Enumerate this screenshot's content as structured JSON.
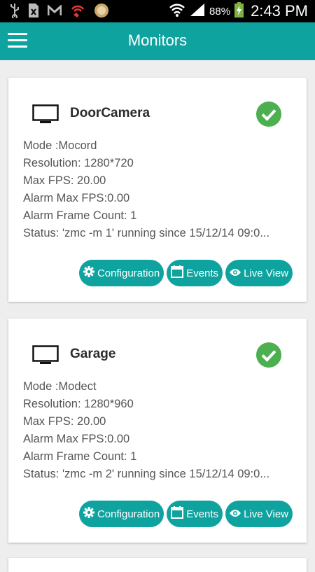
{
  "status_bar": {
    "battery": "88%",
    "time": "2:43 PM",
    "left_icons": [
      "usb-icon",
      "sim-icon",
      "gmail-icon",
      "wifi-calling-icon",
      "app-icon"
    ],
    "right_icons": [
      "wifi-icon",
      "signal-icon",
      "battery-charging-icon"
    ]
  },
  "app_bar": {
    "title": "Monitors",
    "menu_icon": "hamburger-menu-icon"
  },
  "colors": {
    "primary": "#0fa3a0",
    "status_ok": "#4caf50"
  },
  "monitors": [
    {
      "name": "DoorCamera",
      "mode": "Mode :Mocord",
      "resolution": "Resolution: 1280*720",
      "max_fps": "Max FPS: 20.00",
      "alarm_max_fps": "Alarm Max FPS:0.00",
      "alarm_frame_count": "Alarm Frame Count: 1",
      "status": "Status: 'zmc -m 1' running since 15/12/14 09:0...",
      "state_icon": "check-circle-icon"
    },
    {
      "name": "Garage",
      "mode": "Mode :Modect",
      "resolution": "Resolution: 1280*960",
      "max_fps": "Max FPS: 20.00",
      "alarm_max_fps": "Alarm Max FPS:0.00",
      "alarm_frame_count": "Alarm Frame Count: 1",
      "status": "Status: 'zmc -m 2' running since 15/12/14 09:0...",
      "state_icon": "check-circle-icon"
    }
  ],
  "actions": {
    "configuration": "Configuration",
    "events": "Events",
    "live_view": "Live View"
  }
}
